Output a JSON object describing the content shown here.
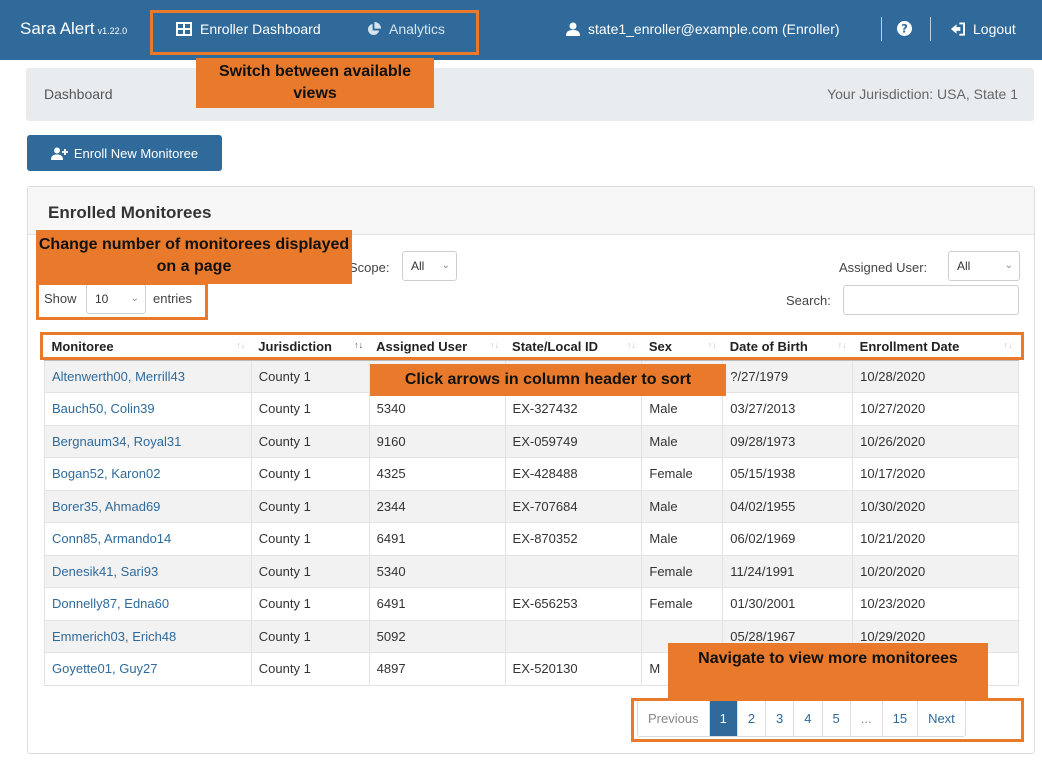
{
  "navbar": {
    "brand": "Sara Alert",
    "version": "v1.22.0",
    "dashboard_label": "Enroller Dashboard",
    "analytics_label": "Analytics",
    "user_label": "state1_enroller@example.com (Enroller)",
    "logout_label": "Logout"
  },
  "breadcrumb": {
    "current": "Dashboard",
    "jurisdiction": "Your Jurisdiction: USA, State 1"
  },
  "enroll_button": "Enroll New Monitoree",
  "card": {
    "title": "Enrolled Monitorees",
    "scope_label": "Scope:",
    "scope_value": "All",
    "assigned_user_label": "Assigned User:",
    "assigned_user_value": "All",
    "show_label": "Show",
    "entries_value": "10",
    "entries_label": "entries",
    "search_label": "Search:",
    "search_value": ""
  },
  "table": {
    "headers": [
      "Monitoree",
      "Jurisdiction",
      "Assigned User",
      "State/Local ID",
      "Sex",
      "Date of Birth",
      "Enrollment Date"
    ],
    "rows": [
      [
        "Altenwerth00, Merrill43",
        "County 1",
        "",
        "",
        "",
        "?/27/1979",
        "10/28/2020"
      ],
      [
        "Bauch50, Colin39",
        "County 1",
        "5340",
        "EX-327432",
        "Male",
        "03/27/2013",
        "10/27/2020"
      ],
      [
        "Bergnaum34, Royal31",
        "County 1",
        "9160",
        "EX-059749",
        "Male",
        "09/28/1973",
        "10/26/2020"
      ],
      [
        "Bogan52, Karon02",
        "County 1",
        "4325",
        "EX-428488",
        "Female",
        "05/15/1938",
        "10/17/2020"
      ],
      [
        "Borer35, Ahmad69",
        "County 1",
        "2344",
        "EX-707684",
        "Male",
        "04/02/1955",
        "10/30/2020"
      ],
      [
        "Conn85, Armando14",
        "County 1",
        "6491",
        "EX-870352",
        "Male",
        "06/02/1969",
        "10/21/2020"
      ],
      [
        "Denesik41, Sari93",
        "County 1",
        "5340",
        "",
        "Female",
        "11/24/1991",
        "10/20/2020"
      ],
      [
        "Donnelly87, Edna60",
        "County 1",
        "6491",
        "EX-656253",
        "Female",
        "01/30/2001",
        "10/23/2020"
      ],
      [
        "Emmerich03, Erich48",
        "County 1",
        "5092",
        "",
        "",
        "05/28/1967",
        "10/29/2020"
      ],
      [
        "Goyette01, Guy27",
        "County 1",
        "4897",
        "EX-520130",
        "M",
        "",
        ""
      ]
    ]
  },
  "pagination": [
    "Previous",
    "1",
    "2",
    "3",
    "4",
    "5",
    "...",
    "15",
    "Next"
  ],
  "annotations": {
    "views": "Switch between available views",
    "entries": "Change number of monitorees displayed on a page",
    "sort": "Click arrows in column header to sort",
    "navigate": "Navigate to view more monitorees"
  },
  "colors": {
    "primary": "#2f6a9b",
    "annotation": "#e97a2b"
  },
  "icons": [
    "user-icon",
    "question-icon",
    "logout-icon",
    "table-icon",
    "analytics-icon",
    "add-user-icon"
  ]
}
